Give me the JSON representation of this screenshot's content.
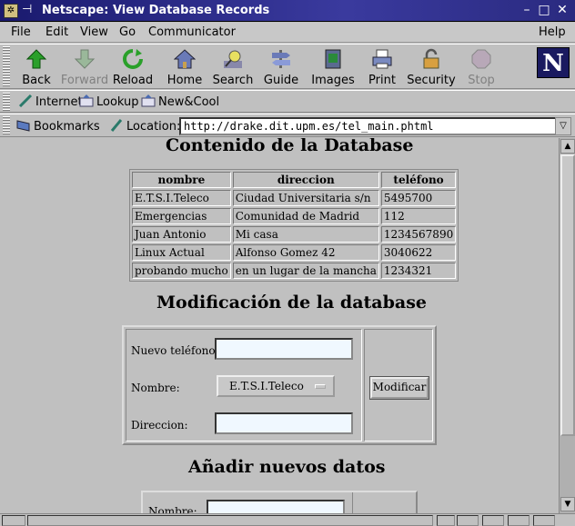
{
  "window": {
    "title": "Netscape: View Database Records",
    "icons": [
      "window-menu-icon",
      "pin-icon",
      "minimize-icon",
      "maximize-icon",
      "close-icon"
    ]
  },
  "menu": {
    "file": "File",
    "edit": "Edit",
    "view": "View",
    "go": "Go",
    "communicator": "Communicator",
    "help": "Help"
  },
  "toolbar": {
    "back": "Back",
    "forward": "Forward",
    "reload": "Reload",
    "home": "Home",
    "search": "Search",
    "guide": "Guide",
    "images": "Images",
    "print": "Print",
    "security": "Security",
    "stop": "Stop"
  },
  "personal": {
    "internet": "Internet",
    "lookup": "Lookup",
    "newcool": "New&Cool"
  },
  "location": {
    "bookmarks": "Bookmarks",
    "label": "Location:",
    "url": "http://drake.dit.upm.es/tel_main.phtml"
  },
  "page": {
    "heading_db": "Contenido de la Database",
    "table": {
      "headers": [
        "nombre",
        "direccion",
        "teléfono"
      ],
      "rows": [
        [
          "E.T.S.I.Teleco",
          "Ciudad Universitaria s/n",
          "5495700"
        ],
        [
          "Emergencias",
          "Comunidad de Madrid",
          "112"
        ],
        [
          "Juan Antonio",
          "Mi casa",
          "1234567890"
        ],
        [
          "Linux Actual",
          "Alfonso Gomez 42",
          "3040622"
        ],
        [
          "probando mucho",
          "en un lugar de la mancha",
          "1234321"
        ]
      ]
    },
    "heading_mod": "Modificación de la database",
    "form_mod": {
      "phone_label": "Nuevo teléfono:",
      "phone_value": "",
      "name_label": "Nombre:",
      "name_selected": "E.T.S.I.Teleco",
      "address_label": "Direccion:",
      "address_value": "",
      "submit": "Modificar"
    },
    "heading_add": "Añadir nuevos datos",
    "form_add": {
      "name_label": "Nombre:"
    }
  }
}
